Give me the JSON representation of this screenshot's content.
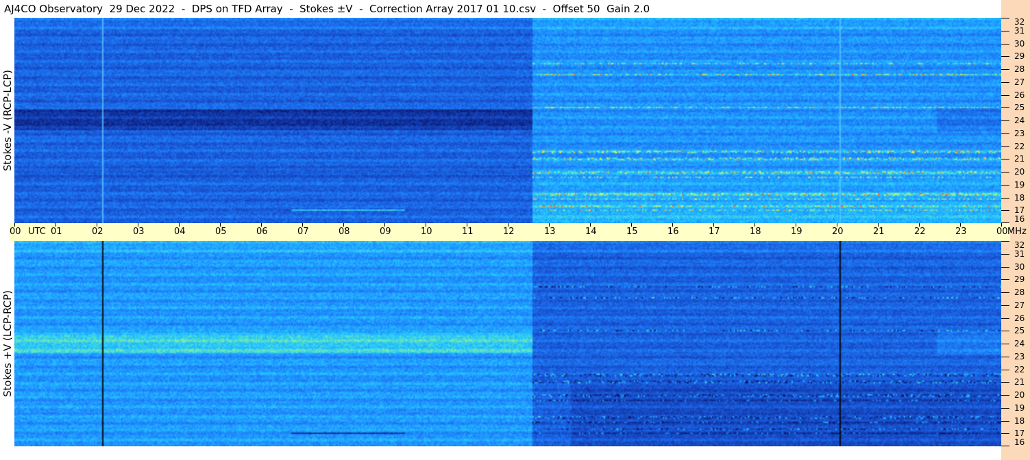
{
  "header": {
    "title": "AJ4CO Observatory  29 Dec 2022  -  DPS on TFD Array  -  Stokes ±V  -  Correction Array 2017 01 10.csv  -  Offset 50  Gain 2.0"
  },
  "chart_data": [
    {
      "type": "heatmap",
      "panel": "top",
      "ylabel": "Stokes -V (RCP-LCP)",
      "x_tick_labels": [
        "00",
        "UTC",
        "01",
        "02",
        "03",
        "04",
        "05",
        "06",
        "07",
        "08",
        "09",
        "10",
        "11",
        "12",
        "13",
        "14",
        "15",
        "16",
        "17",
        "18",
        "19",
        "20",
        "21",
        "22",
        "23",
        "00",
        "MHz"
      ],
      "x_range_utc_hours": [
        0,
        24
      ],
      "y_range_mhz": [
        16,
        32
      ],
      "y_tick_labels": [
        "32",
        "31",
        "30",
        "29",
        "28",
        "27",
        "26",
        "25",
        "24",
        "23",
        "22",
        "21",
        "20",
        "19",
        "18",
        "17",
        "16"
      ],
      "palette": [
        "#0a1060",
        "#1238a8",
        "#1a5ee0",
        "#1f8cff",
        "#24c8ff",
        "#7ef0a0",
        "#ffff40",
        "#ff6020"
      ],
      "vertical_marks_utc": [
        2.12,
        20.05
      ]
    },
    {
      "type": "heatmap",
      "panel": "bottom",
      "ylabel": "Stokes +V (LCP-RCP)",
      "x_range_utc_hours": [
        0,
        24
      ],
      "y_range_mhz": [
        16,
        32
      ],
      "y_tick_labels": [
        "32",
        "31",
        "30",
        "29",
        "28",
        "27",
        "26",
        "25",
        "24",
        "23",
        "22",
        "21",
        "20",
        "19",
        "18",
        "17",
        "16"
      ],
      "palette": [
        "#0a1060",
        "#1238a8",
        "#1a5ee0",
        "#1f8cff",
        "#24c8ff",
        "#7ef0a0",
        "#ffff40",
        "#ff6020"
      ],
      "vertical_marks_utc": [
        2.12,
        20.05
      ]
    }
  ],
  "colors": {
    "time_axis_band": "#ffffc8",
    "freq_axis_band": "#fbd9b9"
  }
}
